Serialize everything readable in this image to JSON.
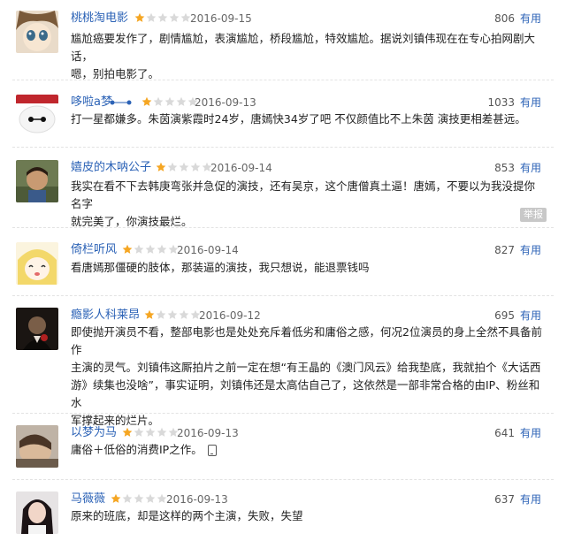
{
  "rating_colors": {
    "filled": "#f5a623",
    "empty": "#d9d9d9"
  },
  "reviews": [
    {
      "user": "桃桃淘电影",
      "rating": 1,
      "date": "2016-09-15",
      "votes": "806",
      "useful": "有用",
      "avatar_icon": "anime-face-avatar",
      "lines": [
        "尴尬癌要发作了，剧情尴尬，表演尴尬，桥段尴尬，特效尴尬。据说刘镇伟现在在专心拍网剧大话，",
        "嗯，别拍电影了。"
      ]
    },
    {
      "user": "哆啦a梦",
      "rating": 1,
      "date": "2016-09-13",
      "votes": "1033",
      "useful": "有用",
      "avatar_icon": "baymax-avatar",
      "lines": [
        "打一星都嫌多。朱茵演紫霞时24岁，唐嫣快34岁了吧 不仅颜值比不上朱茵 演技更相差甚远。"
      ]
    },
    {
      "user": "嬉皮的木呐公子",
      "rating": 1,
      "date": "2016-09-14",
      "votes": "853",
      "useful": "有用",
      "avatar_icon": "child-photo-avatar",
      "report": "举报",
      "lines": [
        "我实在看不下去韩庚弯张并急促的演技，还有吴京，这个唐僧真土逼！唐嫣，不要以为我没提你名字",
        "就完美了，你演技最烂。"
      ]
    },
    {
      "user": "倚栏听风",
      "rating": 1,
      "date": "2016-09-14",
      "votes": "827",
      "useful": "有用",
      "avatar_icon": "cartoon-girl-avatar",
      "lines": [
        "看唐嫣那僵硬的肢体，那装逼的演技，我只想说，能退票钱吗"
      ]
    },
    {
      "user": "瘾影人科莱昂",
      "rating": 1,
      "date": "2016-09-12",
      "votes": "695",
      "useful": "有用",
      "avatar_icon": "godfather-avatar",
      "lines": [
        "即使抛开演员不看，整部电影也是处处充斥着低劣和庸俗之感，何况2位演员的身上全然不具备前作",
        "主演的灵气。刘镇伟这厮拍片之前一定在想“有王晶的《澳门风云》给我垫底，我就拍个《大话西",
        "游》续集也没啥”，事实证明，刘镇伟还是太高估自己了，这依然是一部非常合格的由IP、粉丝和水",
        "军撑起来的烂片。"
      ]
    },
    {
      "user": "以梦为马",
      "rating": 1,
      "date": "2016-09-13",
      "votes": "641",
      "useful": "有用",
      "avatar_icon": "sleeping-person-avatar",
      "lines": [
        "庸俗＋低俗的消费IP之作。"
      ]
    },
    {
      "user": "马薇薇",
      "rating": 1,
      "date": "2016-09-13",
      "votes": "637",
      "useful": "有用",
      "avatar_icon": "woman-portrait-avatar",
      "lines": [
        "原来的班底，却是这样的两个主演，失败，失望"
      ]
    }
  ]
}
